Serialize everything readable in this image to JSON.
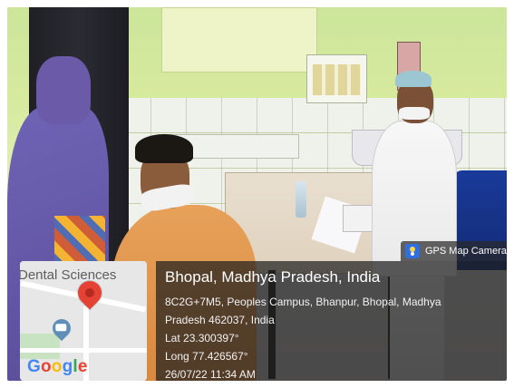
{
  "overlay": {
    "badge_label": "GPS Map Camera",
    "map": {
      "place_label": "Dental Sciences",
      "logo_letters": [
        "G",
        "o",
        "o",
        "g",
        "l",
        "e"
      ]
    },
    "location": {
      "title": "Bhopal, Madhya Pradesh, India",
      "address_line_1": "8C2G+7M5, Peoples Campus, Bhanpur, Bhopal, Madhya",
      "address_line_2": "Pradesh 462037, India",
      "latitude": "Lat 23.300397°",
      "longitude": "Long 77.426567°",
      "timestamp": "26/07/22 11:34 AM"
    }
  }
}
